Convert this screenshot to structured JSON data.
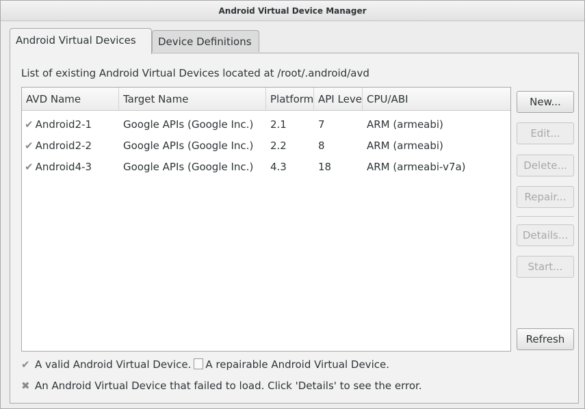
{
  "window": {
    "title": "Android Virtual Device Manager"
  },
  "tabs": [
    {
      "label": "Android Virtual Devices",
      "active": true
    },
    {
      "label": "Device Definitions",
      "active": false
    }
  ],
  "panel": {
    "caption": "List of existing Android Virtual Devices located at /root/.android/avd"
  },
  "table": {
    "columns": [
      "AVD Name",
      "Target Name",
      "Platform",
      "API Level",
      "CPU/ABI"
    ],
    "rows": [
      {
        "status_icon": "check-icon",
        "name": "Android2-1",
        "target": "Google APIs (Google Inc.)",
        "platform": "2.1",
        "api": "7",
        "abi": "ARM (armeabi)"
      },
      {
        "status_icon": "check-icon",
        "name": "Android2-2",
        "target": "Google APIs (Google Inc.)",
        "platform": "2.2",
        "api": "8",
        "abi": "ARM (armeabi)"
      },
      {
        "status_icon": "check-icon",
        "name": "Android4-3",
        "target": "Google APIs (Google Inc.)",
        "platform": "4.3",
        "api": "18",
        "abi": "ARM (armeabi-v7a)"
      }
    ]
  },
  "buttons": {
    "new": "New...",
    "edit": "Edit...",
    "delete": "Delete...",
    "repair": "Repair...",
    "details": "Details...",
    "start": "Start...",
    "refresh": "Refresh"
  },
  "legend": {
    "valid": "A valid Android Virtual Device.",
    "repairable": "A repairable Android Virtual Device.",
    "failed": "An Android Virtual Device that failed to load. Click 'Details' to see the error."
  }
}
